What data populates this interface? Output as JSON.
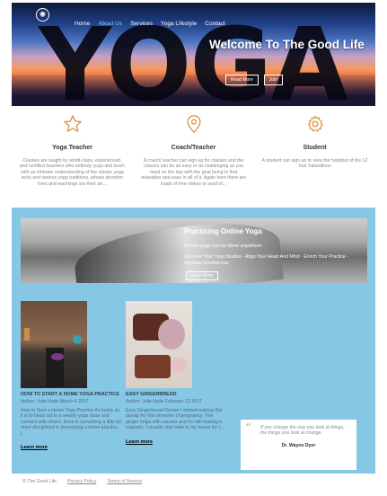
{
  "hero": {
    "logo_glyph": "✺",
    "big_text": "YOGA",
    "headline": "Welcome To The Good Life",
    "buttons": [
      "Read More",
      "Join"
    ]
  },
  "nav": {
    "items": [
      {
        "label": "Home",
        "active": false
      },
      {
        "label": "About Us",
        "active": true
      },
      {
        "label": "Services",
        "active": false
      },
      {
        "label": "Yoga Lifestyle",
        "active": false
      },
      {
        "label": "Contact",
        "active": false
      }
    ]
  },
  "features": [
    {
      "icon": "star-icon",
      "title": "Yoga Teacher",
      "text": "Classes are taught by world-class, experienced, and certified teachers who embody yoga and teach with an intimate understanding of the classic yoga texts and various yoga traditions, whose devotion lives and teachings are their art..."
    },
    {
      "icon": "location-pin-icon",
      "title": "Coach/Teacher",
      "text": "A coach/ teacher can sign up for classes and the classes can be as easy or as challenging as you need on the day with the goal being to find relaxation and ease in all of it. Again here there are loads of free videos to avail of..."
    },
    {
      "icon": "gear-icon",
      "title": "Student",
      "text": "A student can sign up to view the handout of the 12 Sun Salutations"
    }
  ],
  "banner": {
    "title": "Practicing Online Yoga",
    "subtitle": "Online yoga can be done anywhere",
    "description": "Discover Your Yoga Studios - Align Your Heart And Mind - Enrich Your Practice - Increase Mindfulness.",
    "button": "Learn More"
  },
  "posts": [
    {
      "title": "HOW TO START A HOME YOGA PRACTICE",
      "meta": "Author: Julie Hyde March 4 2017",
      "excerpt": "How to Start a Home Yoga Practice As lovely as it is to head out to a weekly yoga class and connect with others, there is something a little bit more disciplined in developing a home practice. I...",
      "more": "Learn more"
    },
    {
      "title": "EASY GINGERBREAD",
      "meta": "Author: Julie Hyde February 13 2017",
      "excerpt": "Easy Gingerbread Recipe I started making this during my first trimester of pregnancy. The ginger helps with nausea and I'm still making it regularly. I usually only bake in my house for I...",
      "more": "Learn more"
    }
  ],
  "quote": {
    "mark": "“",
    "text": "If you change the way you look at things, the things you look at change.",
    "author": "Dr. Wayne Dyer"
  },
  "footer": {
    "copyright": "© The Good Life",
    "links": [
      "Privacy Policy",
      "Terms of Service"
    ]
  }
}
